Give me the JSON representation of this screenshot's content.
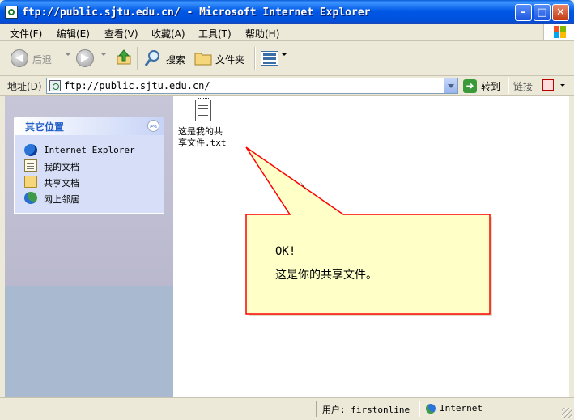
{
  "window": {
    "title": "ftp://public.sjtu.edu.cn/ - Microsoft Internet Explorer",
    "min_label": "–",
    "max_label": "□",
    "close_label": "✕"
  },
  "menu": {
    "items": [
      {
        "label": "文件(F)"
      },
      {
        "label": "编辑(E)"
      },
      {
        "label": "查看(V)"
      },
      {
        "label": "收藏(A)"
      },
      {
        "label": "工具(T)"
      },
      {
        "label": "帮助(H)"
      }
    ]
  },
  "toolbar": {
    "back_label": "后退",
    "search_label": "搜索",
    "folders_label": "文件夹"
  },
  "address": {
    "label": "地址(D)",
    "value": "ftp://public.sjtu.edu.cn/",
    "go_label": "转到",
    "links_label": "链接"
  },
  "sidebar": {
    "panel_title": "其它位置",
    "collapse_glyph": "︽",
    "items": [
      {
        "label": "Internet Explorer",
        "icon": "ie-icon"
      },
      {
        "label": "我的文档",
        "icon": "documents-icon"
      },
      {
        "label": "共享文档",
        "icon": "folder-icon"
      },
      {
        "label": "网上邻居",
        "icon": "network-icon"
      }
    ]
  },
  "content": {
    "file": {
      "name_line1": "这是我的共",
      "name_line2": "享文件.txt"
    },
    "callout": {
      "line1": "OK!",
      "line2": "这是你的共享文件。",
      "fill": "#ffffc8",
      "stroke": "#ff0000"
    }
  },
  "status": {
    "user": "用户: firstonline",
    "zone": "Internet"
  }
}
